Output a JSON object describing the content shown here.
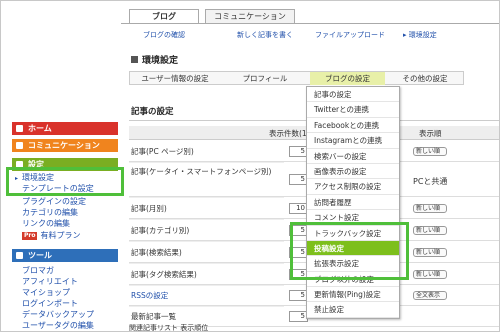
{
  "top_tabs": [
    "ブログ",
    "コミュニケーション"
  ],
  "subnav": [
    "ブログの確認",
    "新しく記事を書く",
    "ファイルアップロード",
    "環境設定"
  ],
  "page_title": "環境設定",
  "settings_tabs": [
    "ユーザー情報の設定",
    "プロフィール",
    "ブログの設定",
    "その他の設定"
  ],
  "section_title": "記事の設定",
  "table_headers": {
    "count": "表示件数(1",
    "order": "表示順"
  },
  "rows": [
    {
      "label": "記事(PC ページ別)",
      "value": "5",
      "order": "新しい順"
    },
    {
      "label": "記事(ケータイ・スマートフォンページ別)",
      "value": "5",
      "order": "PCと共通"
    },
    {
      "label": "記事(月別)",
      "value": "10",
      "order": "新しい順"
    },
    {
      "label": "記事(カテゴリ別)",
      "value": "5",
      "order": "新しい順"
    },
    {
      "label": "記事(検索結果)",
      "value": "5",
      "order": "新しい順"
    },
    {
      "label": "記事(タグ検索結果)",
      "value": "5",
      "order": "新しい順"
    },
    {
      "label": "RSSの設定",
      "value": "5",
      "order": "全文表示"
    },
    {
      "label": "最新記事一覧",
      "value": "5",
      "order": ""
    }
  ],
  "dropdown": [
    "記事の設定",
    "Twitterとの連携",
    "Facebookとの連携",
    "Instagramとの連携",
    "検索バーの設定",
    "画像表示の設定",
    "アクセス制限の設定",
    "訪問者履歴",
    "コメント設定",
    "トラックバック設定",
    "投稿設定",
    "拡張表示設定",
    "ブログ以外の設定",
    "更新情報(Ping)設定",
    "禁止設定"
  ],
  "dropdown_current": "投稿設定",
  "sidebar": {
    "home": "ホーム",
    "comm": "コミュニケーション",
    "settings": "設定",
    "settings_items": [
      "環境設定",
      "テンプレートの設定",
      "プラグインの設定",
      "カテゴリの編集",
      "リンクの編集",
      "有料プラン"
    ],
    "pro_badge": "Pro",
    "tools": "ツール",
    "tool_items": [
      "ブロマガ",
      "アフィリエイト",
      "マイショップ",
      "ログインポート",
      "データバックアップ",
      "ユーザータグの編集"
    ]
  },
  "bottom_text": "関連記事リスト 表示順位",
  "colors": {
    "home": "#d9322b",
    "comm": "#f0841e",
    "settings": "#7aae22",
    "tools": "#2e6fb9",
    "highlight": "#4fbf3a",
    "current": "#7dbf1c"
  }
}
